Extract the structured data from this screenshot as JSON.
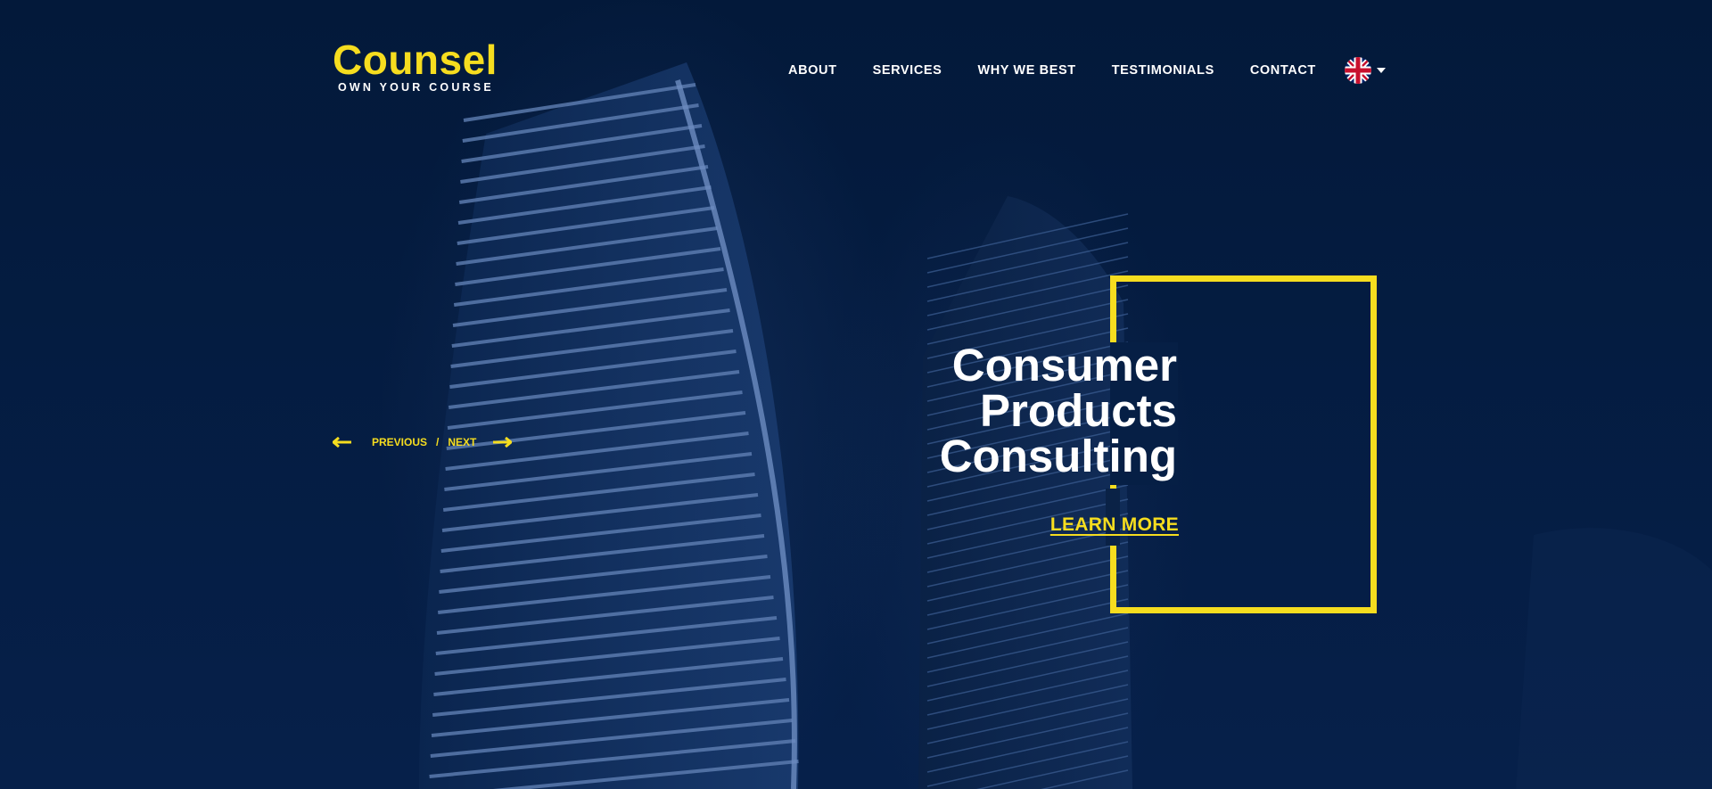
{
  "brand": {
    "name": "Counsel",
    "tagline": "OWN YOUR COURSE"
  },
  "nav": {
    "items": [
      {
        "label": "ABOUT"
      },
      {
        "label": "SERVICES"
      },
      {
        "label": "WHY WE BEST"
      },
      {
        "label": "TESTIMONIALS"
      },
      {
        "label": "CONTACT"
      }
    ],
    "language_icon": "uk-flag-icon"
  },
  "slider": {
    "previous_label": "PREVIOUS",
    "separator": "/",
    "next_label": "NEXT"
  },
  "hero": {
    "headline_lines": [
      "Consumer",
      "Products",
      "Consulting"
    ],
    "cta_label": "LEARN MORE"
  },
  "colors": {
    "background": "#021a3a",
    "accent": "#f6dd1f",
    "text": "#ffffff"
  }
}
